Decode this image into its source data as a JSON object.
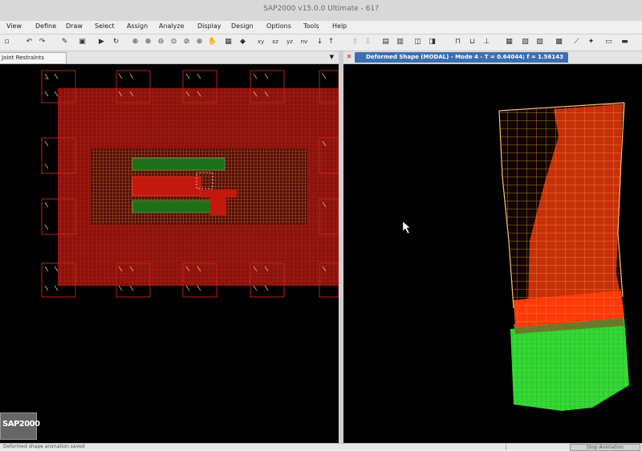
{
  "window": {
    "title": "SAP2000 v15.0.0 Ultimate - 61?"
  },
  "menu": [
    "View",
    "Define",
    "Draw",
    "Select",
    "Assign",
    "Analyze",
    "Display",
    "Design",
    "Options",
    "Tools",
    "Help"
  ],
  "toolbar": {
    "buttons": [
      "xy",
      "xz",
      "yz",
      "nv"
    ]
  },
  "left_panel": {
    "title": "Joint Restraints"
  },
  "right_panel": {
    "title": "Deformed Shape (MODAL) - Mode 4 - T = 0.64044; f = 1.56143"
  },
  "logo": {
    "text": "SAP2000"
  },
  "status": {
    "message": "Deformed shape animation saved",
    "animation_button": "Stop Animation"
  },
  "colors": {
    "mesh": "#b31a12",
    "core": "#e8b23c",
    "wall": "#1f7a1a",
    "tower": "#ff6a1f",
    "podium": "#33e033"
  }
}
